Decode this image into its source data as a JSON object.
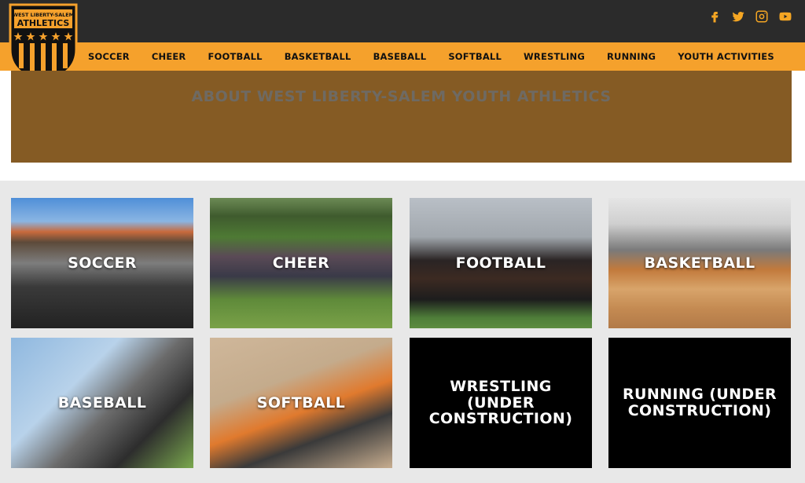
{
  "header": {
    "logo": {
      "line1": "WEST LIBERTY-SALEM",
      "line2": "ATHLETICS"
    },
    "social": [
      {
        "name": "facebook-icon",
        "glyph": "f"
      },
      {
        "name": "twitter-icon",
        "glyph": "t"
      },
      {
        "name": "instagram-icon",
        "glyph": "i"
      },
      {
        "name": "youtube-icon",
        "glyph": "y"
      }
    ],
    "nav": [
      "SOCCER",
      "CHEER",
      "FOOTBALL",
      "BASKETBALL",
      "BASEBALL",
      "SOFTBALL",
      "WRESTLING",
      "RUNNING",
      "YOUTH ACTIVITIES"
    ]
  },
  "hero": {
    "title": "ABOUT WEST LIBERTY-SALEM YOUTH ATHLETICS"
  },
  "cards": [
    {
      "label": "SOCCER"
    },
    {
      "label": "CHEER"
    },
    {
      "label": "FOOTBALL"
    },
    {
      "label": "BASKETBALL"
    },
    {
      "label": "BASEBALL"
    },
    {
      "label": "SOFTBALL"
    },
    {
      "label": "WRESTLING (UNDER CONSTRUCTION)"
    },
    {
      "label": "RUNNING (UNDER CONSTRUCTION)"
    }
  ],
  "colors": {
    "topbar": "#2b2b2b",
    "accent": "#f5a12c",
    "hero": "#855b24",
    "hero_text": "#6e6a63"
  }
}
